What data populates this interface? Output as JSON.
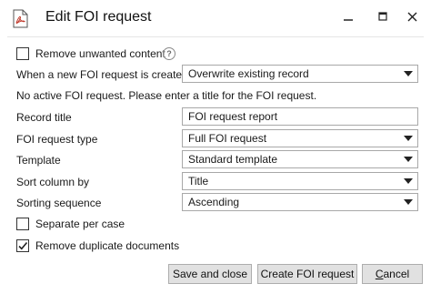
{
  "window": {
    "title": "Edit FOI request",
    "icons": {
      "app": "pdf-document-icon",
      "minimize": "minimize-icon",
      "maximize": "maximize-icon",
      "close": "close-icon"
    }
  },
  "form": {
    "remove_unwanted": {
      "label": "Remove unwanted content",
      "checked": false,
      "help_icon": "help-icon"
    },
    "when_new": {
      "label": "When a new FOI request is created",
      "value": "Overwrite existing record"
    },
    "info_text": "No active FOI request. Please enter a title for the FOI request.",
    "record_title": {
      "label": "Record title",
      "value": "FOI request report"
    },
    "request_type": {
      "label": "FOI request type",
      "value": "Full FOI request"
    },
    "template": {
      "label": "Template",
      "value": "Standard template"
    },
    "sort_column": {
      "label": "Sort column by",
      "value": "Title"
    },
    "sorting_sequence": {
      "label": "Sorting sequence",
      "value": "Ascending"
    },
    "separate_per_case": {
      "label": "Separate per case",
      "checked": false
    },
    "remove_duplicates": {
      "label": "Remove duplicate documents",
      "checked": true
    }
  },
  "buttons": {
    "save_close": "Save and close",
    "create": "Create FOI request",
    "cancel": "Cancel"
  }
}
